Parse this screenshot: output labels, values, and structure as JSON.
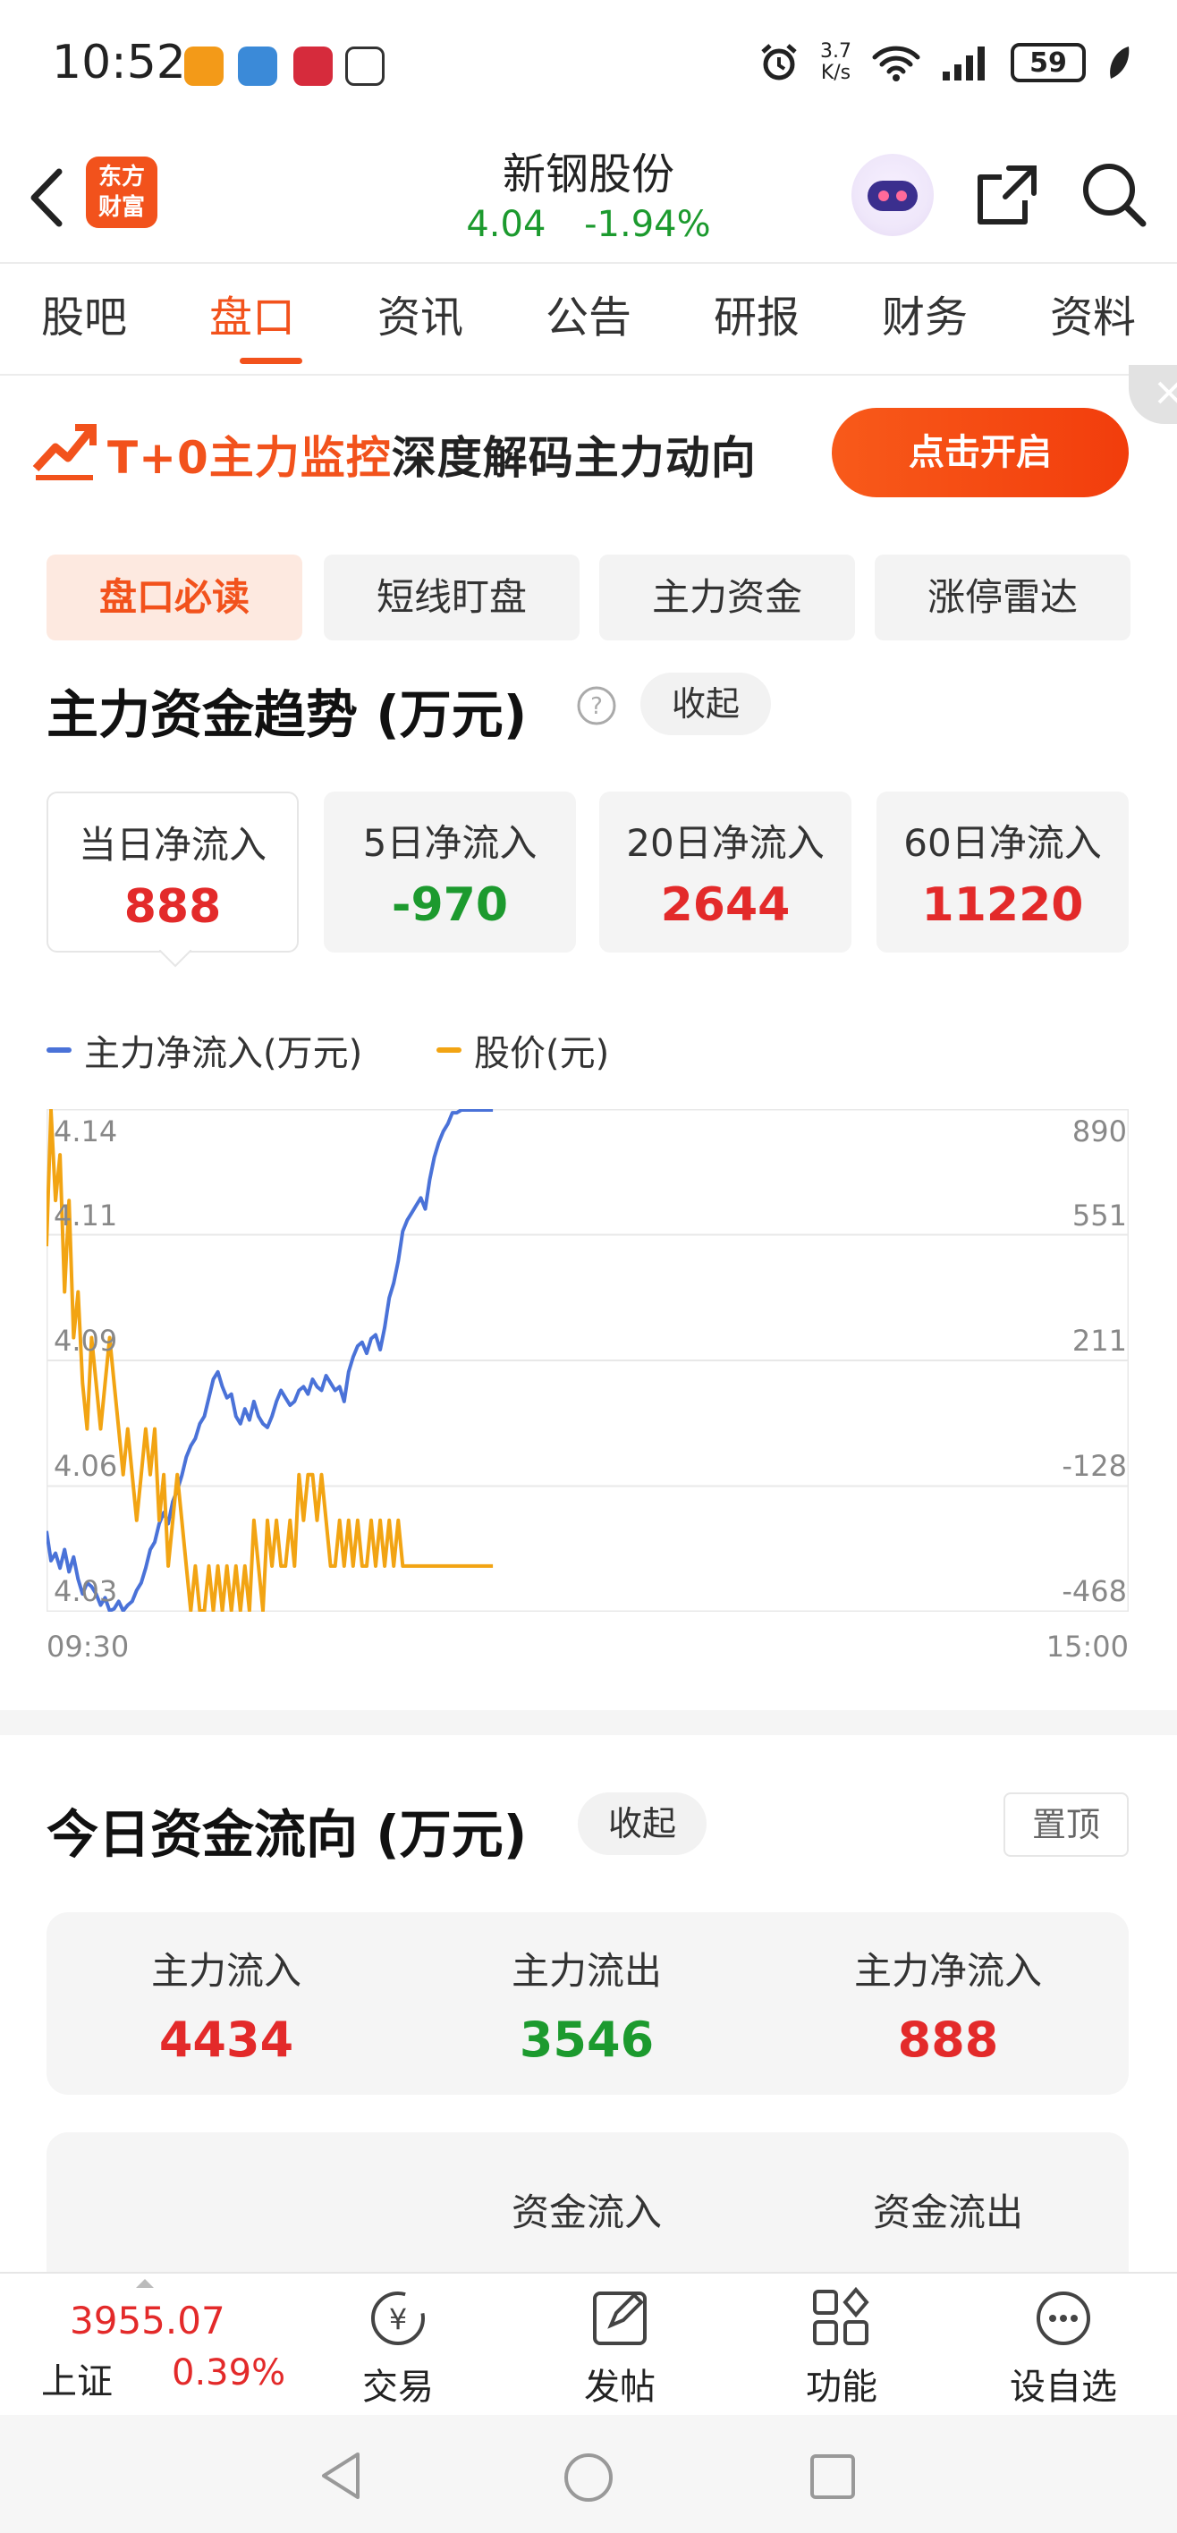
{
  "status_bar": {
    "time": "10:52",
    "net_speed_top": "3.7",
    "net_speed_bottom": "K/s",
    "battery": "59"
  },
  "header": {
    "logo_line1": "东方",
    "logo_line2": "财富",
    "title": "新钢股份",
    "price": "4.04",
    "change": "-1.94%"
  },
  "tabs": [
    "股吧",
    "盘口",
    "资讯",
    "公告",
    "研报",
    "财务",
    "资料"
  ],
  "banner": {
    "text_highlight": "T+0主力监控",
    "text_rest": "深度解码主力动向",
    "button": "点击开启"
  },
  "sub_tabs": [
    "盘口必读",
    "短线盯盘",
    "主力资金",
    "涨停雷达"
  ],
  "trend": {
    "title": "主力资金趋势 (万元)",
    "collapse": "收起",
    "cards": [
      {
        "label": "当日净流入",
        "value": "888",
        "color": "#e32a2a"
      },
      {
        "label": "5日净流入",
        "value": "-970",
        "color": "#1c9a2e"
      },
      {
        "label": "20日净流入",
        "value": "2644",
        "color": "#e32a2a"
      },
      {
        "label": "60日净流入",
        "value": "11220",
        "color": "#e32a2a"
      }
    ]
  },
  "chart_data": {
    "type": "line",
    "series": [
      {
        "name": "主力净流入(万元)",
        "color": "#4a72d8",
        "axis": "right",
        "x": [
          0,
          1,
          2,
          3,
          4,
          5,
          6,
          7,
          8,
          9,
          10,
          11,
          12,
          13,
          14,
          15,
          16,
          17,
          18,
          19,
          20,
          21,
          22,
          23,
          24,
          25,
          26,
          27,
          28,
          29,
          30,
          31,
          32,
          33,
          34,
          35,
          36,
          37,
          38,
          39,
          40,
          41,
          42,
          43,
          44,
          45,
          46,
          47,
          48,
          49,
          50,
          51,
          52,
          53,
          54,
          55,
          56,
          57,
          58,
          59,
          60,
          61,
          62,
          63,
          64,
          65,
          66,
          67,
          68,
          69,
          70,
          71,
          72,
          73,
          74,
          75,
          76,
          77,
          78,
          79,
          80,
          81,
          82,
          83,
          84,
          85,
          86,
          87,
          88,
          89,
          90,
          91,
          92,
          93,
          94,
          95,
          96,
          97,
          98,
          99
        ],
        "values": [
          -250,
          -330,
          -310,
          -350,
          -300,
          -360,
          -320,
          -380,
          -420,
          -390,
          -400,
          -420,
          -450,
          -430,
          -470,
          -460,
          -440,
          -470,
          -450,
          -440,
          -410,
          -390,
          -350,
          -300,
          -280,
          -230,
          -200,
          -230,
          -170,
          -140,
          -100,
          -50,
          -20,
          0,
          40,
          60,
          110,
          160,
          180,
          140,
          110,
          120,
          60,
          40,
          80,
          50,
          100,
          60,
          40,
          30,
          60,
          100,
          130,
          110,
          90,
          100,
          130,
          140,
          120,
          160,
          140,
          130,
          170,
          150,
          130,
          140,
          100,
          180,
          220,
          250,
          260,
          230,
          270,
          280,
          240,
          300,
          380,
          420,
          480,
          560,
          590,
          610,
          630,
          650,
          620,
          700,
          760,
          800,
          830,
          850,
          880,
          880,
          890,
          890,
          890,
          890,
          890,
          890,
          890,
          890
        ],
        "note_x": "minutes index"
      },
      {
        "name": "股价(元)",
        "color": "#f2a413",
        "axis": "left",
        "x": [
          0,
          1,
          2,
          3,
          4,
          5,
          6,
          7,
          8,
          9,
          10,
          11,
          12,
          13,
          14,
          15,
          16,
          17,
          18,
          19,
          20,
          21,
          22,
          23,
          24,
          25,
          26,
          27,
          28,
          29,
          30,
          31,
          32,
          33,
          34,
          35,
          36,
          37,
          38,
          39,
          40,
          41,
          42,
          43,
          44,
          45,
          46,
          47,
          48,
          49,
          50,
          51,
          52,
          53,
          54,
          55,
          56,
          57,
          58,
          59,
          60,
          61,
          62,
          63,
          64,
          65,
          66,
          67,
          68,
          69,
          70,
          71,
          72,
          73,
          74,
          75,
          76,
          77,
          78,
          79,
          80,
          81,
          82,
          83,
          84,
          85,
          86,
          87,
          88,
          89,
          90,
          91,
          92,
          93,
          94,
          95,
          96,
          97,
          98,
          99
        ],
        "values": [
          4.11,
          4.14,
          4.12,
          4.13,
          4.1,
          4.12,
          4.09,
          4.1,
          4.08,
          4.07,
          4.09,
          4.08,
          4.07,
          4.08,
          4.09,
          4.08,
          4.07,
          4.06,
          4.07,
          4.06,
          4.05,
          4.06,
          4.07,
          4.06,
          4.07,
          4.05,
          4.06,
          4.04,
          4.05,
          4.06,
          4.05,
          4.04,
          4.03,
          4.04,
          4.03,
          4.03,
          4.04,
          4.03,
          4.04,
          4.03,
          4.04,
          4.03,
          4.04,
          4.03,
          4.04,
          4.03,
          4.05,
          4.04,
          4.03,
          4.05,
          4.04,
          4.05,
          4.04,
          4.04,
          4.05,
          4.04,
          4.06,
          4.05,
          4.06,
          4.06,
          4.05,
          4.06,
          4.05,
          4.04,
          4.04,
          4.05,
          4.04,
          4.05,
          4.04,
          4.05,
          4.04,
          4.04,
          4.05,
          4.04,
          4.05,
          4.04,
          4.05,
          4.04,
          4.05,
          4.04,
          4.04,
          4.04,
          4.04,
          4.04,
          4.04,
          4.04,
          4.04,
          4.04,
          4.04,
          4.04,
          4.04,
          4.04,
          4.04,
          4.04,
          4.04,
          4.04,
          4.04,
          4.04,
          4.04,
          4.04
        ]
      }
    ],
    "left_ticks": [
      "4.14",
      "4.11",
      "4.09",
      "4.06",
      "4.03"
    ],
    "right_ticks": [
      "890",
      "551",
      "211",
      "-128",
      "-468"
    ],
    "x_ticks": [
      "09:30",
      "15:00"
    ],
    "ylim_left": [
      4.03,
      4.14
    ],
    "ylim_right": [
      -468,
      890
    ],
    "legend_placement": "top-left",
    "grid": true
  },
  "flow": {
    "title": "今日资金流向 (万元)",
    "collapse": "收起",
    "pin": "置顶",
    "stats": [
      {
        "label": "主力流入",
        "value": "4434",
        "color": "#e32a2a"
      },
      {
        "label": "主力流出",
        "value": "3546",
        "color": "#1c9a2e"
      },
      {
        "label": "主力净流入",
        "value": "888",
        "color": "#e32a2a"
      }
    ],
    "table_headers": [
      "资金流入",
      "资金流出"
    ]
  },
  "bottom_bar": {
    "index_value": "3955.07",
    "index_name": "上证",
    "index_change": "0.39%",
    "items": [
      "交易",
      "发帖",
      "功能",
      "设自选"
    ]
  }
}
